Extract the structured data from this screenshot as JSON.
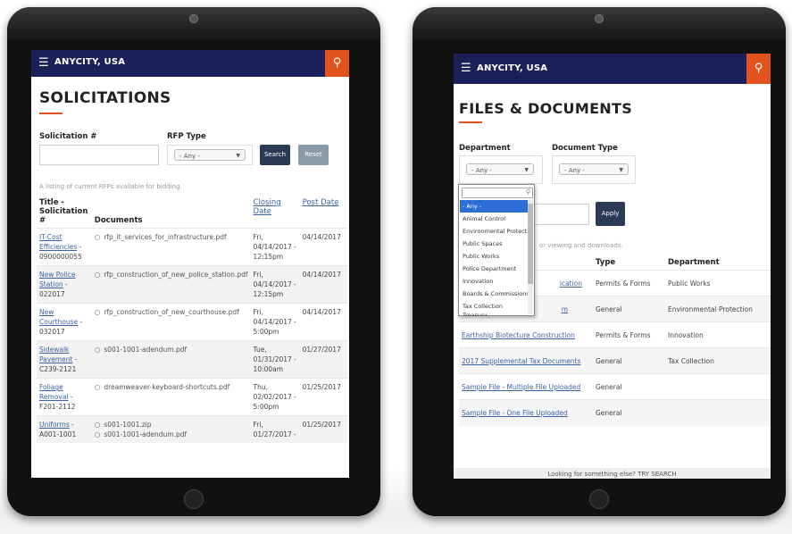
{
  "colors": {
    "nav": "#1c2058",
    "accent": "#e1521d",
    "link": "#3b63a5",
    "button": "#2b3a55",
    "reset": "#8a9aa6"
  },
  "left": {
    "nav": {
      "menu_icon": "hamburger-icon",
      "brand": "ANYCITY, USA",
      "search_icon": "search-icon"
    },
    "title": "SOLICITATIONS",
    "filters": {
      "solicitation_label": "Solicitation #",
      "solicitation_value": "",
      "rfp_label": "RFP Type",
      "rfp_selected": "- Any -",
      "search_label": "Search",
      "reset_label": "Reset"
    },
    "note": "A listing of current RFPs available for bidding.",
    "table": {
      "headers": {
        "title": "Title - Solicitation #",
        "documents": "Documents",
        "closing": "Closing Date",
        "post": "Post Date"
      },
      "rows": [
        {
          "title": "IT-Cost Efficiencies",
          "number": "- 0900000055",
          "docs": [
            "rfp_it_services_for_infrastructure.pdf"
          ],
          "closing": "Fri, 04/14/2017 - 12:15pm",
          "post": "04/14/2017"
        },
        {
          "title": "New Police Station",
          "number": "- 022017",
          "docs": [
            "rfp_construction_of_new_police_station.pdf"
          ],
          "closing": "Fri, 04/14/2017 - 12:15pm",
          "post": "04/14/2017"
        },
        {
          "title": "New Courthouse",
          "number": "- 032017",
          "docs": [
            "rfp_construction_of_new_courthouse.pdf"
          ],
          "closing": "Fri, 04/14/2017 - 5:00pm",
          "post": "04/14/2017"
        },
        {
          "title": "Sidewalk Pavement",
          "number": "- C239-2121",
          "docs": [
            "s001-1001-adendum.pdf"
          ],
          "closing": "Tue, 01/31/2017 - 10:00am",
          "post": "01/27/2017"
        },
        {
          "title": "Foliage Removal",
          "number": "- F201-2112",
          "docs": [
            "dreamweaver-keyboard-shortcuts.pdf"
          ],
          "closing": "Thu, 02/02/2017 - 5:00pm",
          "post": "01/25/2017"
        },
        {
          "title": "Uniforms",
          "number": "- A001-1001",
          "docs": [
            "s001-1001.zip",
            "s001-1001-adendum.pdf"
          ],
          "closing": "Fri, 01/27/2017 -",
          "post": "01/25/2017"
        }
      ]
    }
  },
  "right": {
    "nav": {
      "menu_icon": "hamburger-icon",
      "brand": "ANYCITY, USA",
      "search_icon": "search-icon"
    },
    "title": "FILES & DOCUMENTS",
    "filters": {
      "department_label": "Department",
      "department_selected": "- Any -",
      "doctype_label": "Document Type",
      "doctype_selected": "- Any -",
      "apply_label": "Apply"
    },
    "dropdown_options": [
      "- Any -",
      "Animal Control",
      "Environmental Protection",
      "Public Spaces",
      "Public Works",
      "Police Department",
      "Innovation",
      "Boards & Commissions",
      "Tax Collection",
      "Treasury"
    ],
    "note": "or viewing and downloads.",
    "table": {
      "headers": {
        "type": "Type",
        "department": "Department"
      },
      "rows": [
        {
          "name": "ication",
          "type": "Permits & Forms",
          "department": "Public Works"
        },
        {
          "name": "m",
          "type": "General",
          "department": "Environmental Protection"
        },
        {
          "name": "Earthship Biotecture Construction",
          "type": "Permits & Forms",
          "department": "Innovation"
        },
        {
          "name": "2017 Supplemental Tax Documents",
          "type": "General",
          "department": "Tax Collection"
        },
        {
          "name": "Sample File - Multiple File Uploaded",
          "type": "General",
          "department": ""
        },
        {
          "name": "Sample File - One File Uploaded",
          "type": "General",
          "department": ""
        }
      ]
    },
    "footer": "Looking for something else? TRY SEARCH"
  }
}
